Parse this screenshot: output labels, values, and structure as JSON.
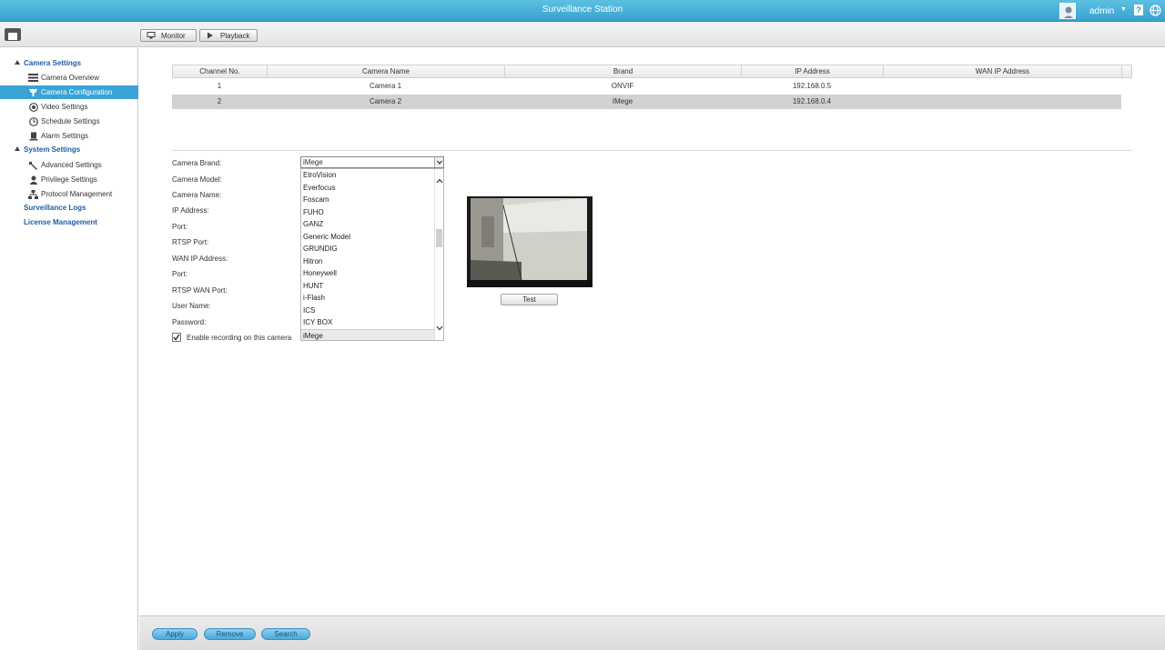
{
  "app": {
    "title": "Surveillance Station",
    "user": "admin",
    "help_glyph": "?"
  },
  "toolbar": {
    "monitor_label": "Monitor",
    "playback_label": "Playback"
  },
  "sidebar": {
    "camera_settings": "Camera Settings",
    "camera_items": [
      {
        "label": "Camera Overview",
        "icon": "list-icon"
      },
      {
        "label": "Camera Configuration",
        "icon": "camera-icon"
      },
      {
        "label": "Video Settings",
        "icon": "record-icon"
      },
      {
        "label": "Schedule Settings",
        "icon": "clock-icon"
      },
      {
        "label": "Alarm Settings",
        "icon": "alarm-icon"
      }
    ],
    "system_settings": "System Settings",
    "system_items": [
      {
        "label": "Advanced Settings",
        "icon": "wrench-icon"
      },
      {
        "label": "Privilege Settings",
        "icon": "user-icon"
      },
      {
        "label": "Protocol Management",
        "icon": "network-icon"
      }
    ],
    "surveillance_logs": "Surveillance Logs",
    "license_management": "License Management"
  },
  "table": {
    "headers": [
      "Channel No.",
      "Camera Name",
      "Brand",
      "IP Address",
      "WAN IP Address"
    ],
    "rows": [
      [
        "1",
        "Camera 1",
        "ONVIF",
        "192.168.0.5",
        ""
      ],
      [
        "2",
        "Camera 2",
        "IMege",
        "192.168.0.4",
        ""
      ]
    ]
  },
  "form": {
    "labels": [
      "Camera Brand:",
      "Camera Model:",
      "Camera Name:",
      "IP Address:",
      "Port:",
      "RTSP Port:",
      "WAN IP Address:",
      "Port:",
      "RTSP WAN Port:",
      "User Name:",
      "Password:"
    ],
    "brand_value": "iMege",
    "brand_options": [
      "EtroVision",
      "Everfocus",
      "Foscam",
      "FUHO",
      "GANZ",
      "Generic Model",
      "GRUNDIG",
      "Hitron",
      "Honeywell",
      "HUNT",
      "i-Flash",
      "ICS",
      "ICY BOX",
      "iMege"
    ],
    "enable_recording_label": "Enable recording on this camera",
    "test_label": "Test"
  },
  "footer": {
    "apply_label": "Apply",
    "remove_label": "Remove",
    "search_label": "Search"
  },
  "colors": {
    "titlebar": "#38a2cf",
    "active_nav": "#3aa3d6",
    "nav_heading": "#1d5fa6"
  }
}
